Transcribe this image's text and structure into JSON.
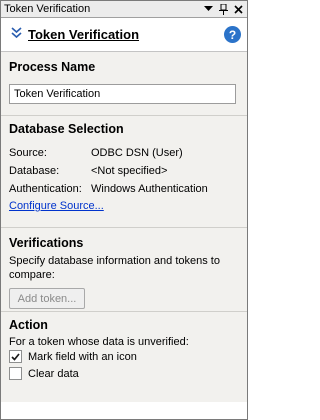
{
  "window": {
    "title": "Token Verification"
  },
  "header": {
    "title": "Token Verification",
    "help_label": "?"
  },
  "process_name": {
    "section_title": "Process Name",
    "value": "Token Verification"
  },
  "database": {
    "section_title": "Database Selection",
    "rows": [
      {
        "label": "Source:",
        "value": "ODBC DSN (User)"
      },
      {
        "label": "Database:",
        "value": "<Not specified>"
      },
      {
        "label": "Authentication:",
        "value": "Windows Authentication"
      }
    ],
    "configure_link": "Configure Source..."
  },
  "verifications": {
    "section_title": "Verifications",
    "description": "Specify database information and tokens to compare:",
    "add_button": "Add token..."
  },
  "action": {
    "section_title": "Action",
    "description": "For a token whose data is unverified:",
    "options": [
      {
        "label": "Mark field with an icon",
        "checked": true
      },
      {
        "label": "Clear data",
        "checked": false
      }
    ]
  }
}
